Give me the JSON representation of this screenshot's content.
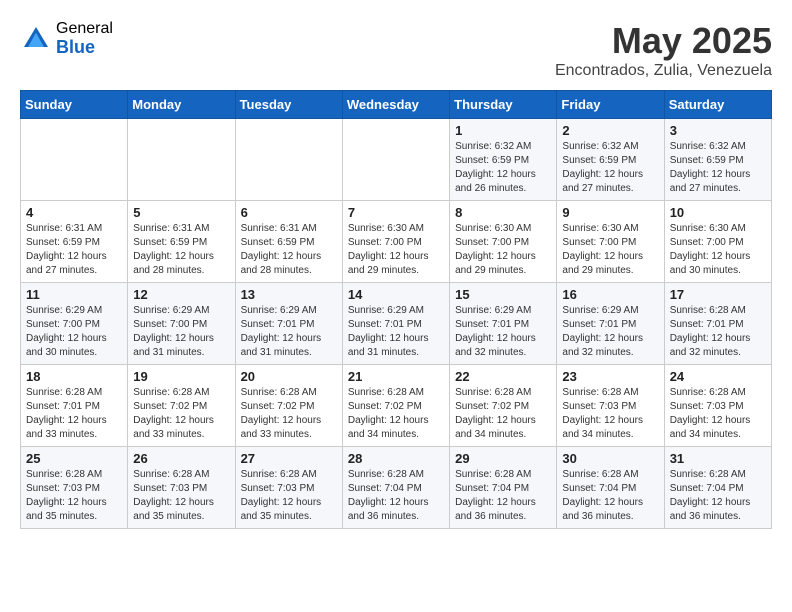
{
  "logo": {
    "general": "General",
    "blue": "Blue"
  },
  "title": {
    "month_year": "May 2025",
    "location": "Encontrados, Zulia, Venezuela"
  },
  "days_of_week": [
    "Sunday",
    "Monday",
    "Tuesday",
    "Wednesday",
    "Thursday",
    "Friday",
    "Saturday"
  ],
  "weeks": [
    [
      {
        "day": "",
        "info": ""
      },
      {
        "day": "",
        "info": ""
      },
      {
        "day": "",
        "info": ""
      },
      {
        "day": "",
        "info": ""
      },
      {
        "day": "1",
        "info": "Sunrise: 6:32 AM\nSunset: 6:59 PM\nDaylight: 12 hours and 26 minutes."
      },
      {
        "day": "2",
        "info": "Sunrise: 6:32 AM\nSunset: 6:59 PM\nDaylight: 12 hours and 27 minutes."
      },
      {
        "day": "3",
        "info": "Sunrise: 6:32 AM\nSunset: 6:59 PM\nDaylight: 12 hours and 27 minutes."
      }
    ],
    [
      {
        "day": "4",
        "info": "Sunrise: 6:31 AM\nSunset: 6:59 PM\nDaylight: 12 hours and 27 minutes."
      },
      {
        "day": "5",
        "info": "Sunrise: 6:31 AM\nSunset: 6:59 PM\nDaylight: 12 hours and 28 minutes."
      },
      {
        "day": "6",
        "info": "Sunrise: 6:31 AM\nSunset: 6:59 PM\nDaylight: 12 hours and 28 minutes."
      },
      {
        "day": "7",
        "info": "Sunrise: 6:30 AM\nSunset: 7:00 PM\nDaylight: 12 hours and 29 minutes."
      },
      {
        "day": "8",
        "info": "Sunrise: 6:30 AM\nSunset: 7:00 PM\nDaylight: 12 hours and 29 minutes."
      },
      {
        "day": "9",
        "info": "Sunrise: 6:30 AM\nSunset: 7:00 PM\nDaylight: 12 hours and 29 minutes."
      },
      {
        "day": "10",
        "info": "Sunrise: 6:30 AM\nSunset: 7:00 PM\nDaylight: 12 hours and 30 minutes."
      }
    ],
    [
      {
        "day": "11",
        "info": "Sunrise: 6:29 AM\nSunset: 7:00 PM\nDaylight: 12 hours and 30 minutes."
      },
      {
        "day": "12",
        "info": "Sunrise: 6:29 AM\nSunset: 7:00 PM\nDaylight: 12 hours and 31 minutes."
      },
      {
        "day": "13",
        "info": "Sunrise: 6:29 AM\nSunset: 7:01 PM\nDaylight: 12 hours and 31 minutes."
      },
      {
        "day": "14",
        "info": "Sunrise: 6:29 AM\nSunset: 7:01 PM\nDaylight: 12 hours and 31 minutes."
      },
      {
        "day": "15",
        "info": "Sunrise: 6:29 AM\nSunset: 7:01 PM\nDaylight: 12 hours and 32 minutes."
      },
      {
        "day": "16",
        "info": "Sunrise: 6:29 AM\nSunset: 7:01 PM\nDaylight: 12 hours and 32 minutes."
      },
      {
        "day": "17",
        "info": "Sunrise: 6:28 AM\nSunset: 7:01 PM\nDaylight: 12 hours and 32 minutes."
      }
    ],
    [
      {
        "day": "18",
        "info": "Sunrise: 6:28 AM\nSunset: 7:01 PM\nDaylight: 12 hours and 33 minutes."
      },
      {
        "day": "19",
        "info": "Sunrise: 6:28 AM\nSunset: 7:02 PM\nDaylight: 12 hours and 33 minutes."
      },
      {
        "day": "20",
        "info": "Sunrise: 6:28 AM\nSunset: 7:02 PM\nDaylight: 12 hours and 33 minutes."
      },
      {
        "day": "21",
        "info": "Sunrise: 6:28 AM\nSunset: 7:02 PM\nDaylight: 12 hours and 34 minutes."
      },
      {
        "day": "22",
        "info": "Sunrise: 6:28 AM\nSunset: 7:02 PM\nDaylight: 12 hours and 34 minutes."
      },
      {
        "day": "23",
        "info": "Sunrise: 6:28 AM\nSunset: 7:03 PM\nDaylight: 12 hours and 34 minutes."
      },
      {
        "day": "24",
        "info": "Sunrise: 6:28 AM\nSunset: 7:03 PM\nDaylight: 12 hours and 34 minutes."
      }
    ],
    [
      {
        "day": "25",
        "info": "Sunrise: 6:28 AM\nSunset: 7:03 PM\nDaylight: 12 hours and 35 minutes."
      },
      {
        "day": "26",
        "info": "Sunrise: 6:28 AM\nSunset: 7:03 PM\nDaylight: 12 hours and 35 minutes."
      },
      {
        "day": "27",
        "info": "Sunrise: 6:28 AM\nSunset: 7:03 PM\nDaylight: 12 hours and 35 minutes."
      },
      {
        "day": "28",
        "info": "Sunrise: 6:28 AM\nSunset: 7:04 PM\nDaylight: 12 hours and 36 minutes."
      },
      {
        "day": "29",
        "info": "Sunrise: 6:28 AM\nSunset: 7:04 PM\nDaylight: 12 hours and 36 minutes."
      },
      {
        "day": "30",
        "info": "Sunrise: 6:28 AM\nSunset: 7:04 PM\nDaylight: 12 hours and 36 minutes."
      },
      {
        "day": "31",
        "info": "Sunrise: 6:28 AM\nSunset: 7:04 PM\nDaylight: 12 hours and 36 minutes."
      }
    ]
  ]
}
